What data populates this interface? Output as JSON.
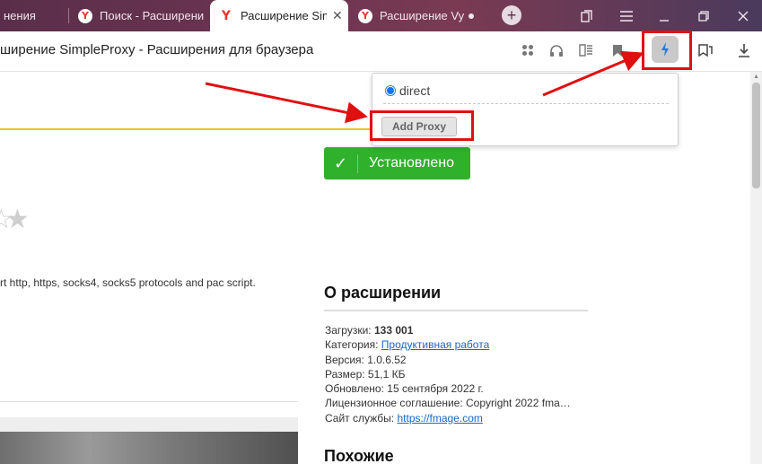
{
  "tabs": [
    {
      "title": "нения"
    },
    {
      "title": "Поиск - Расширени"
    },
    {
      "title": "Расширение Sim"
    },
    {
      "title": "Расширение Vy"
    }
  ],
  "page_title": "ширение SimpleProxy - Расширения для браузера",
  "popup": {
    "proxy_option": "direct",
    "add_button": "Add Proxy"
  },
  "install_button": {
    "check": "✓",
    "label": "Установлено"
  },
  "rating": {
    "value": 0,
    "max": 5
  },
  "description": "rt http, https, socks4, socks5 protocols and pac script.",
  "about": {
    "title": "О расширении",
    "downloads_label": "Загрузки:",
    "downloads_value": "133 001",
    "category_label": "Категория:",
    "category_value": "Продуктивная работа",
    "version_label": "Версия:",
    "version_value": "1.0.6.52",
    "size_label": "Размер:",
    "size_value": "51,1 КБ",
    "updated_label": "Обновлено:",
    "updated_value": "15 сентября 2022 г.",
    "license_label": "Лицензионное соглашение:",
    "license_value": "Copyright 2022 fma…",
    "site_label": "Сайт службы:",
    "site_value": "https://fmage.com"
  },
  "similar_title": "Похожие",
  "colors": {
    "install_green": "#2fb12b",
    "annotation_red": "#e01010",
    "link_blue": "#1a66c8",
    "accent_yellow": "#f0c419"
  },
  "icons": {
    "favicon": "yandex-icon",
    "extension": "lightning-icon",
    "toolbar": [
      "apps-icon",
      "headphones-icon",
      "reader-icon",
      "bookmark-icon",
      "collections-icon",
      "download-icon"
    ]
  }
}
